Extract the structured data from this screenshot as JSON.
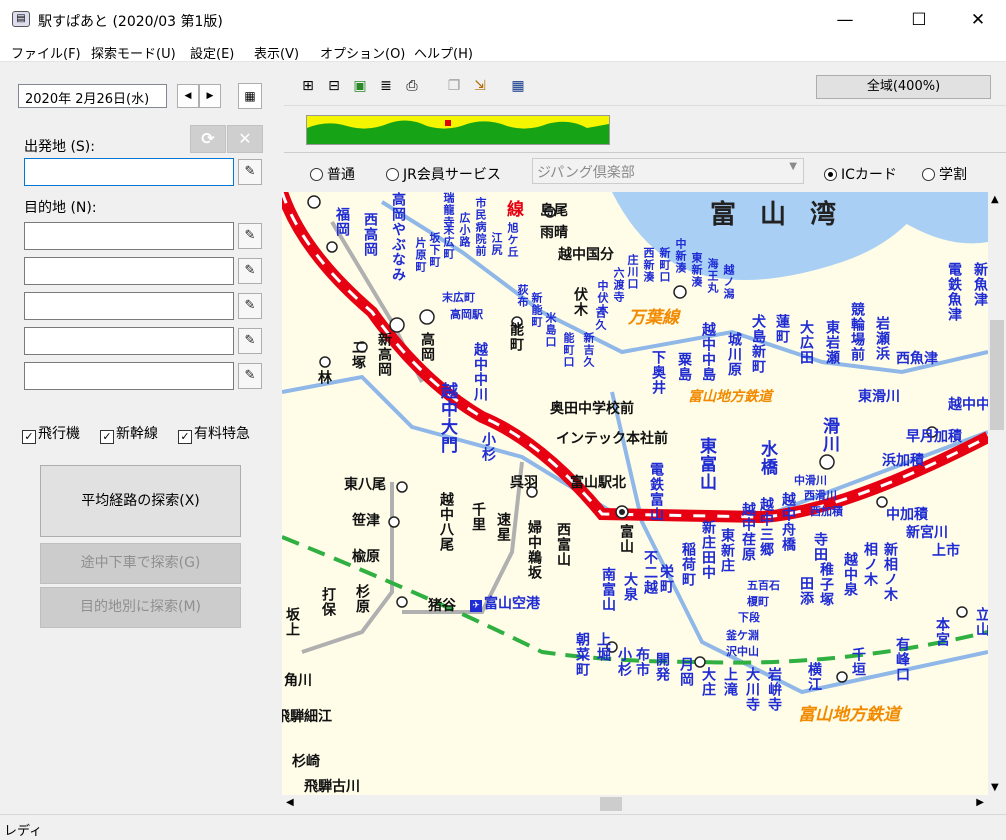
{
  "window": {
    "app_icon": "train-icon",
    "title": "駅すぱあと (2020/03 第1版)",
    "minimize": "—",
    "maximize": "☐",
    "close": "✕"
  },
  "menu": [
    "ファイル(F)",
    "探索モード(U)",
    "設定(E)",
    "表示(V)",
    "オプション(O)",
    "ヘルプ(H)"
  ],
  "left": {
    "date": "2020年 2月26日(水)",
    "prev_icon": "triangle-left-icon",
    "next_icon": "triangle-right-icon",
    "calendar_icon": "calendar-icon",
    "departure_label": "出発地 (S):",
    "destination_label": "目的地 (N):",
    "swap_icon": "refresh-icon",
    "clear_icon": "x-icon",
    "departure_value": "",
    "destination_values": [
      "",
      "",
      "",
      "",
      ""
    ],
    "pencil_icon": "pencil-icon",
    "checks": [
      {
        "label": "飛行機",
        "checked": true
      },
      {
        "label": "新幹線",
        "checked": true
      },
      {
        "label": "有料特急",
        "checked": true
      }
    ],
    "search_avg": "平均経路の探索(X)",
    "search_stopover": "途中下車で探索(G)",
    "search_by_dest": "目的地別に探索(M)"
  },
  "toolbar": {
    "icons": [
      "route-window-icon",
      "route-tree-icon",
      "map-view-icon",
      "list-icon",
      "print-preview-icon",
      "copy-icon",
      "export-icon",
      "timetable-icon"
    ],
    "area_button": "全域(400%)"
  },
  "fare_options": {
    "radio_normal": "普通",
    "radio_jr": "JR会員サービス",
    "combo_value": "ジパング倶楽部",
    "radio_ic": "ICカード",
    "radio_student": "学割",
    "selected": "ICカード"
  },
  "map": {
    "sea": "富山湾",
    "colors": {
      "shinkansen": "#e60012",
      "jr": "#8fb7e8",
      "private": "#b0b0b0",
      "airport_line": "#2fb040",
      "sea": "#a9cff5",
      "station_text": "#1f2bd3"
    },
    "labels_vertical": [
      "福岡",
      "西高岡",
      "高岡やぶなみ",
      "新高岡",
      "高岡",
      "二塚",
      "林",
      "能町",
      "越中中川",
      "越中大門",
      "小杉",
      "越中八尾",
      "千里",
      "速星",
      "婦中鵜坂",
      "西富山",
      "富山",
      "電鉄富山",
      "東富山",
      "水橋",
      "滑川",
      "越中三郷",
      "越中舟橋",
      "新庄田中",
      "東新庄",
      "稲荷町",
      "不二越",
      "大泉",
      "南富山",
      "栄町",
      "朝菜町",
      "上堀",
      "小杉",
      "布市",
      "開発",
      "月岡",
      "大庄",
      "上滝",
      "大川寺",
      "岩峅寺",
      "横江",
      "千垣",
      "有峰口",
      "本宮",
      "立山",
      "打保",
      "杉原",
      "坂上",
      "越中荏原",
      "寺田",
      "相ノ木",
      "新相ノ木",
      "越中泉",
      "稚子塚",
      "田添",
      "下奥井",
      "粟島",
      "越中中島",
      "城川原",
      "犬島新町",
      "蓮町",
      "大広田",
      "東岩瀬",
      "競輪場前",
      "岩瀬浜",
      "電鉄魚津",
      "新魚津",
      "伏木",
      "米島口",
      "能町口",
      "新吉久",
      "吉久",
      "中伏木",
      "六渡寺",
      "庄川口",
      "西新湊",
      "新町口",
      "中新湊",
      "東新湊",
      "海王丸",
      "越ノ潟",
      "市民病院前",
      "広小路",
      "末広町",
      "片原町",
      "坂下町",
      "瑞龍寺",
      "荻布",
      "新能町",
      "旭ケ丘",
      "江尻"
    ],
    "labels_horizontal": [
      "島尾",
      "雨晴",
      "越中国分",
      "末広町",
      "高岡駅",
      "東八尾",
      "笹津",
      "楡原",
      "猪谷",
      "呉羽",
      "富山駅北",
      "奥田中学校前",
      "インテック本社前",
      "中加積",
      "新宮川",
      "上市",
      "西魚津",
      "東滑川",
      "越中中村",
      "早月加積",
      "浜加積",
      "西加積",
      "中滑川",
      "西滑川",
      "五百石",
      "榎町",
      "下段",
      "釜ケ淵",
      "沢中山",
      "角川",
      "飛騨細江",
      "杉崎",
      "飛騨古川",
      "富山空港"
    ],
    "line_labels": [
      "万葉線",
      "富山地方鉄道",
      "富山地方鉄道"
    ],
    "line_fragment": "線"
  },
  "status": {
    "text": "レディ"
  }
}
